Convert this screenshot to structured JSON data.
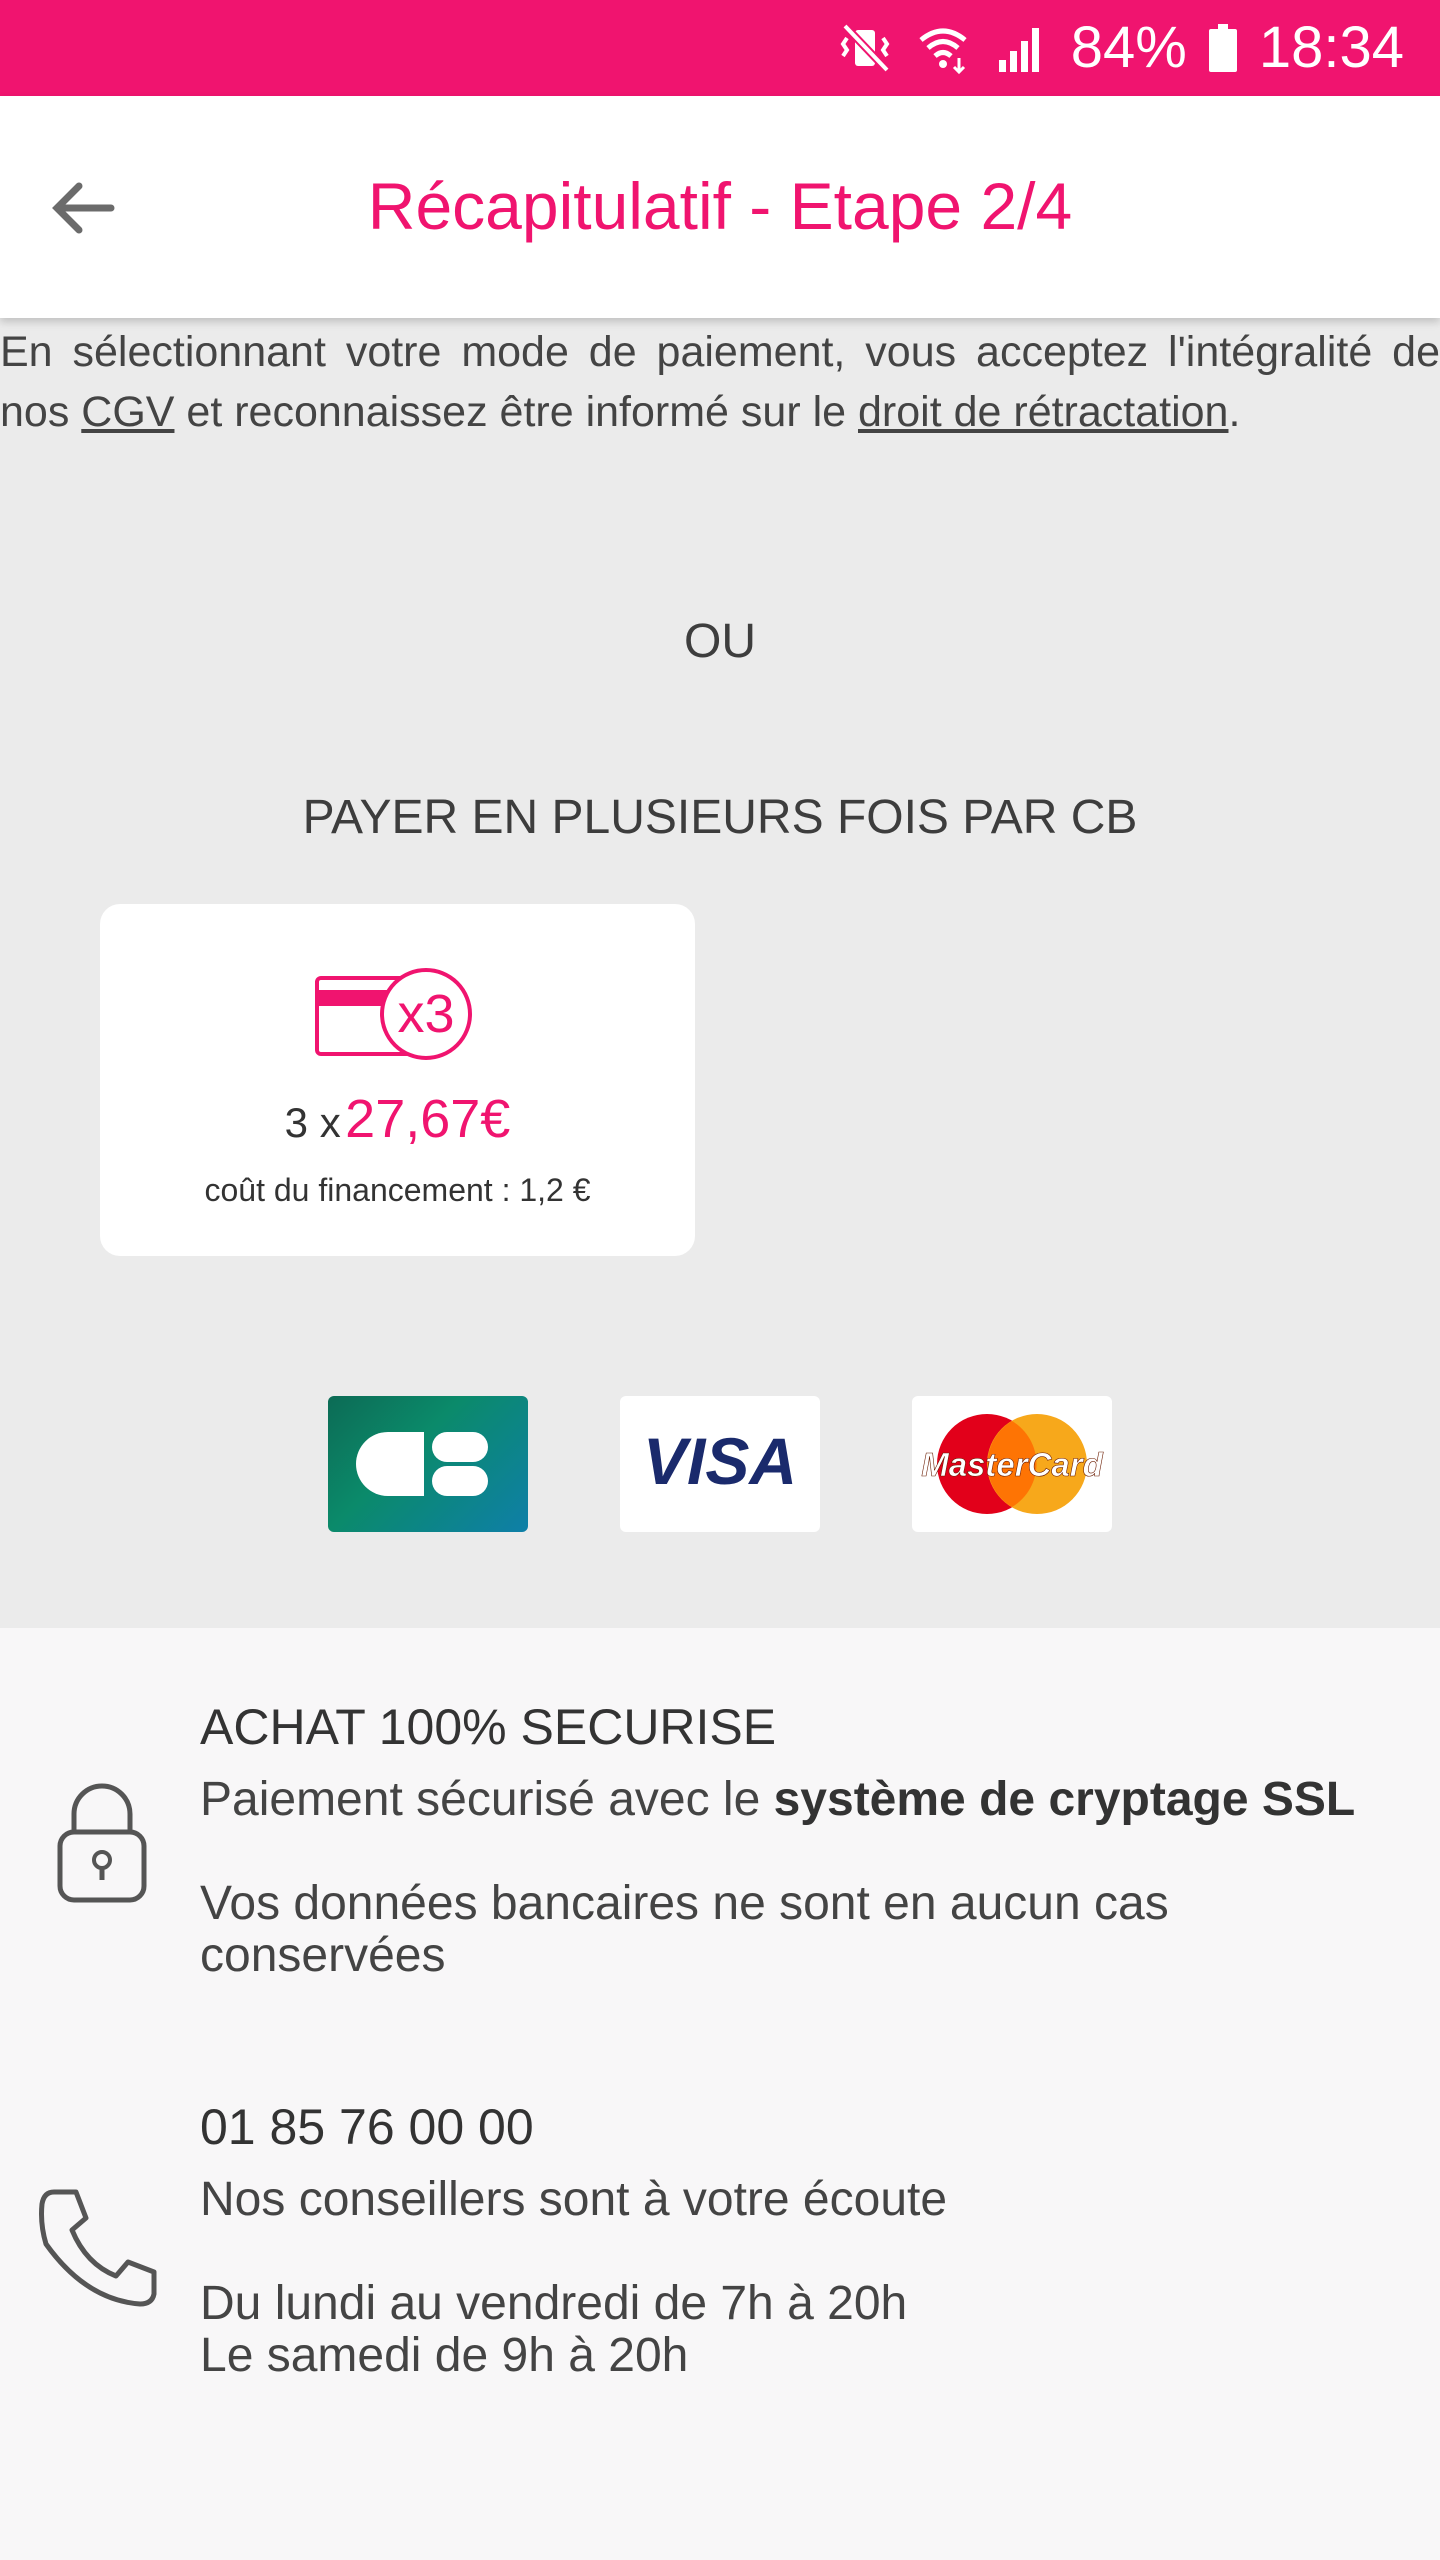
{
  "status_bar": {
    "battery": "84%",
    "time": "18:34"
  },
  "app_bar": {
    "title": "Récapitulatif - Etape 2/4"
  },
  "legal": {
    "text1": "En sélectionnant votre mode de paiement, vous acceptez l'intégralité de nos ",
    "link_cgv": "CGV",
    "text2": " et reconnaissez être informé sur le ",
    "link_retractation": "droit de rétractation",
    "text3": "."
  },
  "separator": "OU",
  "installments": {
    "heading": "PAYER EN PLUSIEURS FOIS PAR CB",
    "card": {
      "badge": "x3",
      "prefix": "3 x",
      "amount": "27,67€",
      "cost": "coût du financement : 1,2 €"
    }
  },
  "payment_logos": [
    "CB",
    "VISA",
    "MasterCard"
  ],
  "security": {
    "heading": "ACHAT 100% SECURISE",
    "line1_prefix": "Paiement sécurisé avec le ",
    "line1_bold": "système de cryptage SSL",
    "line2": "Vos données bancaires ne sont en aucun cas conservées"
  },
  "contact": {
    "phone": "01 85 76 00 00",
    "line1": "Nos conseillers sont à votre écoute",
    "hours1": "Du lundi au vendredi de 7h à 20h",
    "hours2": "Le samedi de 9h à 20h"
  },
  "colors": {
    "brand": "#f0146f",
    "page_bg": "#ebebeb",
    "bottom_bg": "#f8f7f8"
  }
}
